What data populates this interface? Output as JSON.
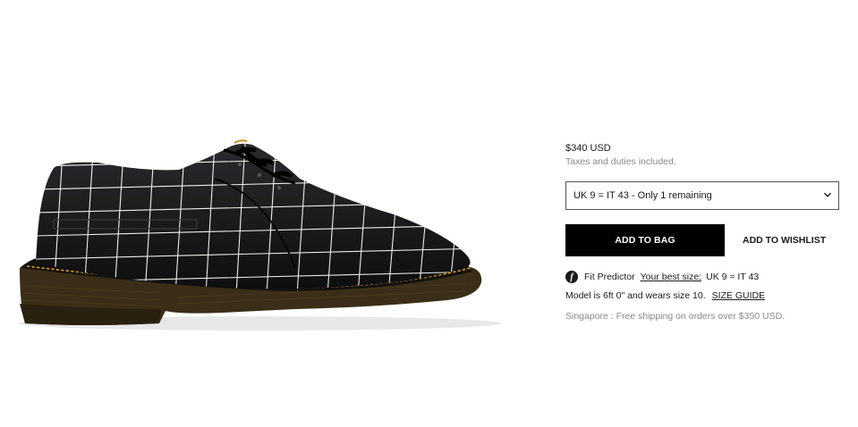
{
  "product": {
    "price": "$340 USD",
    "taxes_note": "Taxes and duties included.",
    "size_select": {
      "selected": "UK 9 = IT 43 - Only 1 remaining",
      "icon": "chevron-down-icon"
    },
    "add_to_bag_label": "ADD TO BAG",
    "add_to_wishlist_label": "ADD TO WISHLIST",
    "fit_predictor": {
      "icon": "fit-predictor-icon",
      "label": "Fit Predictor",
      "best_size_link": "Your best size:",
      "best_size_value": "UK 9 = IT 43"
    },
    "model_note": "Model is 6ft 0\" and wears size 10.",
    "size_guide_link": "SIZE GUIDE",
    "shipping_note": "Singapore : Free shipping on orders over $350 USD."
  },
  "colors": {
    "button_bg": "#000000",
    "muted_text": "#8a8a8a",
    "stitch": "#e0a020",
    "grid_line": "#ffffff",
    "sole": "#3a2e18"
  }
}
